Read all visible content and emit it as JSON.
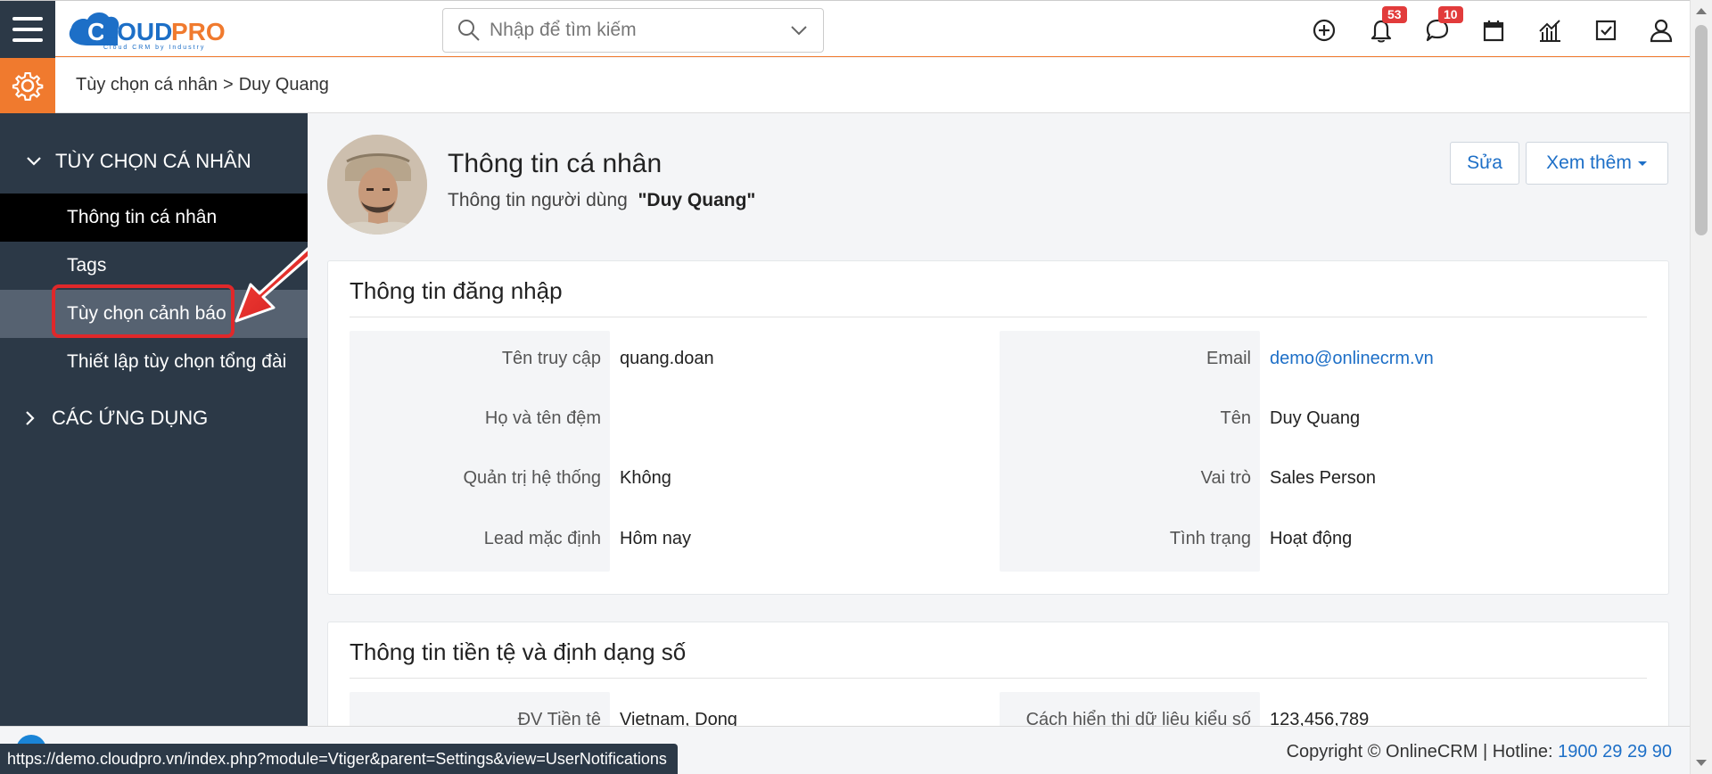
{
  "app": {
    "logo_text": "CLOUDPRO",
    "logo_tagline": "Cloud CRM by Industry"
  },
  "search": {
    "placeholder": "Nhập để tìm kiếm"
  },
  "toolbar": {
    "notifications_count": "53",
    "messages_count": "10"
  },
  "breadcrumb": {
    "parent": "Tùy chọn cá nhân",
    "separator": ">",
    "current": "Duy Quang"
  },
  "sidebar": {
    "section1_title": "TÙY CHỌN CÁ NHÂN",
    "items": [
      {
        "label": "Thông tin cá nhân"
      },
      {
        "label": "Tags"
      },
      {
        "label": "Tùy chọn cảnh báo"
      },
      {
        "label": "Thiết lập tùy chọn tổng đài"
      }
    ],
    "section2_title": "CÁC ỨNG DỤNG"
  },
  "profile": {
    "title": "Thông tin cá nhân",
    "subtitle_prefix": "Thông tin người dùng",
    "subtitle_name": "\"Duy Quang\"",
    "edit_label": "Sửa",
    "more_label": "Xem thêm"
  },
  "login_card": {
    "title": "Thông tin đăng nhập",
    "left": [
      {
        "label": "Tên truy cập",
        "value": "quang.doan"
      },
      {
        "label": "Họ và tên đệm",
        "value": ""
      },
      {
        "label": "Quản trị hệ thống",
        "value": "Không"
      },
      {
        "label": "Lead mặc định",
        "value": "Hôm nay"
      }
    ],
    "right": [
      {
        "label": "Email",
        "value": "demo@onlinecrm.vn"
      },
      {
        "label": "Tên",
        "value": "Duy Quang"
      },
      {
        "label": "Vai trò",
        "value": "Sales Person"
      },
      {
        "label": "Tình trạng",
        "value": "Hoạt động"
      }
    ]
  },
  "currency_card": {
    "title": "Thông tin tiền tệ và định dạng số",
    "left": [
      {
        "label": "ĐV Tiền tệ",
        "value": "Vietnam, Dong"
      }
    ],
    "right": [
      {
        "label": "Cách hiển thị dữ liệu kiểu số",
        "value": "123,456,789"
      }
    ]
  },
  "footer": {
    "copyright": "Copyright © OnlineCRM",
    "hotline_label": "Hotline:",
    "hotline": "1900 29 29 90"
  },
  "status_url": "https://demo.cloudpro.vn/index.php?module=Vtiger&parent=Settings&view=UserNotifications",
  "colors": {
    "sidebar_bg": "#2c3947",
    "accent_orange": "#f07a2e",
    "link_blue": "#1d6fc7",
    "highlight_red": "#e0282a",
    "badge_red": "#e23b3b"
  },
  "icons": [
    "menu-icon",
    "search-icon",
    "chevron-down-icon",
    "add-icon",
    "bell-icon",
    "chat-icon",
    "calendar-icon",
    "chart-icon",
    "task-icon",
    "user-icon",
    "gear-icon"
  ]
}
